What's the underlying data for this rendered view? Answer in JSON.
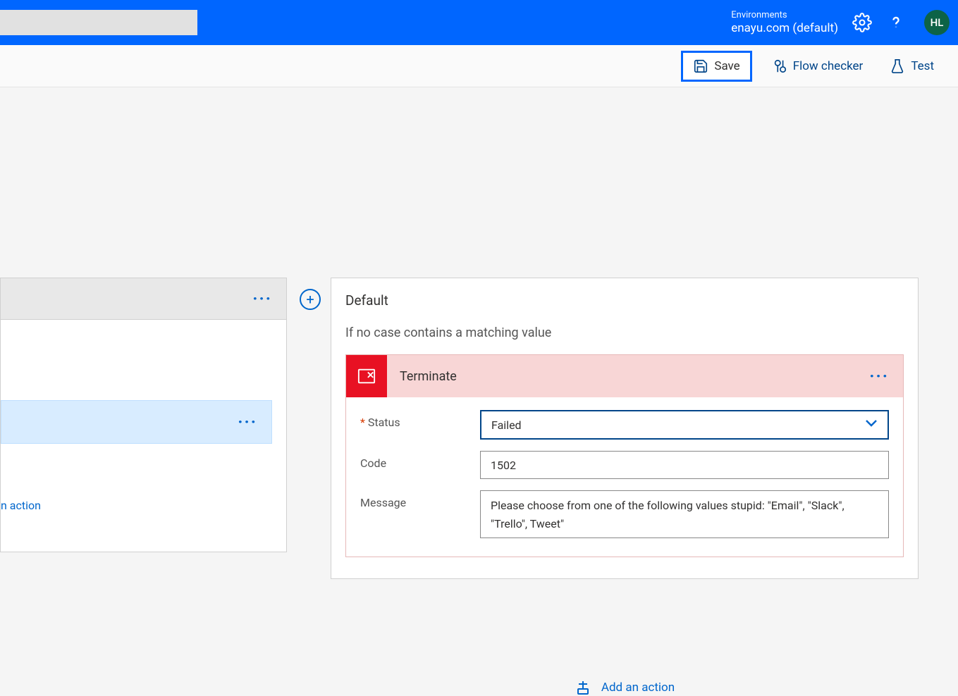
{
  "header": {
    "environments_label": "Environments",
    "environment_name": "enayu.com (default)",
    "avatar_initials": "HL"
  },
  "toolbar": {
    "save_label": "Save",
    "flow_checker_label": "Flow checker",
    "test_label": "Test"
  },
  "left": {
    "action_link": "n action"
  },
  "default_card": {
    "title": "Default",
    "subtitle": "If no case contains a matching value"
  },
  "terminate": {
    "title": "Terminate",
    "fields": {
      "status_label": "Status",
      "status_value": "Failed",
      "code_label": "Code",
      "code_value": "1502",
      "message_label": "Message",
      "message_value": "Please choose from one of the following values stupid: \"Email\", \"Slack\", \"Trello\", Tweet\""
    }
  },
  "add_action_label": "Add an action"
}
